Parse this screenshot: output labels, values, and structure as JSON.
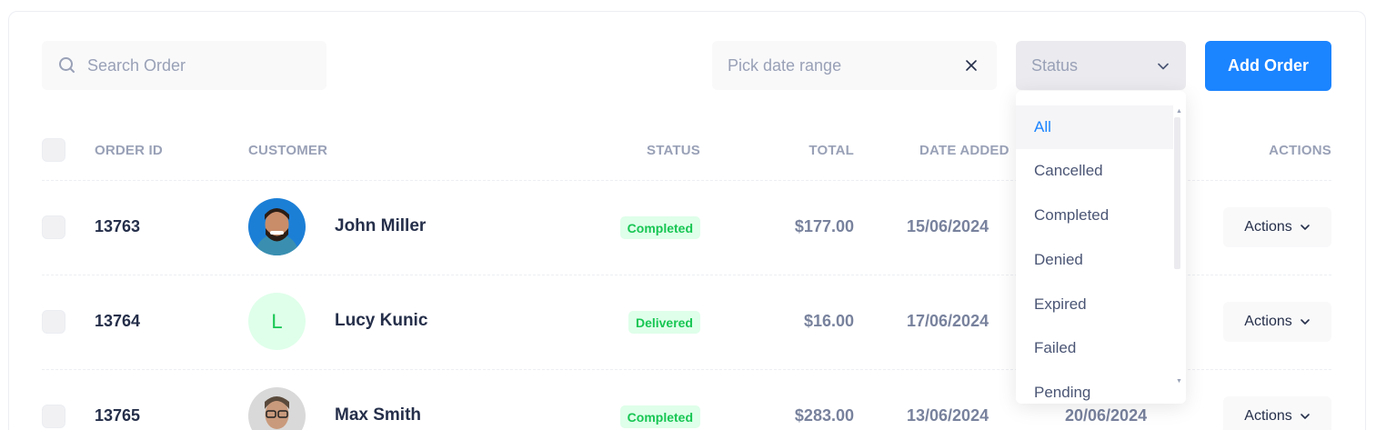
{
  "toolbar": {
    "search_placeholder": "Search Order",
    "date_placeholder": "Pick date range",
    "status_label": "Status",
    "add_button": "Add Order"
  },
  "table": {
    "headers": {
      "order_id": "ORDER ID",
      "customer": "CUSTOMER",
      "status": "STATUS",
      "total": "TOTAL",
      "date_added": "DATE ADDED",
      "actions": "ACTIONS"
    },
    "rows": [
      {
        "id": "13763",
        "customer": "John Miller",
        "avatar": "photo",
        "status": "Completed",
        "total": "$177.00",
        "date_added": "15/06/2024",
        "date_modified": "",
        "actions": "Actions"
      },
      {
        "id": "13764",
        "customer": "Lucy Kunic",
        "avatar_letter": "L",
        "status": "Delivered",
        "total": "$16.00",
        "date_added": "17/06/2024",
        "date_modified": "",
        "actions": "Actions"
      },
      {
        "id": "13765",
        "customer": "Max Smith",
        "avatar": "photo",
        "status": "Completed",
        "total": "$283.00",
        "date_added": "13/06/2024",
        "date_modified": "20/06/2024",
        "actions": "Actions"
      }
    ]
  },
  "status_dropdown": {
    "options": [
      "All",
      "Cancelled",
      "Completed",
      "Denied",
      "Expired",
      "Failed",
      "Pending"
    ],
    "selected": "All"
  },
  "colors": {
    "accent": "#1b84ff",
    "success": "#17c653",
    "success_light": "#dfffea",
    "muted": "#99a1b7"
  }
}
